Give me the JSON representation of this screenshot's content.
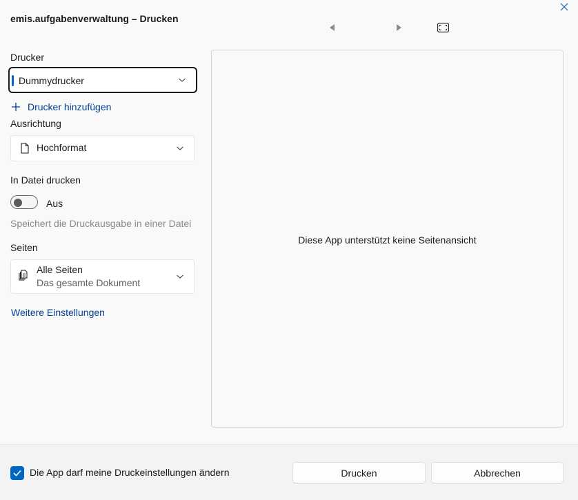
{
  "window": {
    "title": "emis.aufgabenverwaltung – Drucken"
  },
  "printer": {
    "label": "Drucker",
    "selected": "Dummydrucker",
    "add_link": "Drucker hinzufügen"
  },
  "orientation": {
    "label": "Ausrichtung",
    "selected": "Hochformat"
  },
  "print_to_file": {
    "label": "In Datei drucken",
    "state_text": "Aus",
    "description": "Speichert die Druckausgabe in einer Datei"
  },
  "pages": {
    "label": "Seiten",
    "selected": "Alle Seiten",
    "selected_subtitle": "Das gesamte Dokument"
  },
  "more_settings_link": "Weitere Einstellungen",
  "preview": {
    "message": "Diese App unterstützt keine Seitenansicht"
  },
  "footer": {
    "checkbox_label": "Die App darf meine Druckeinstellungen ändern",
    "checkbox_checked": true,
    "print_button": "Drucken",
    "cancel_button": "Abbrechen"
  },
  "colors": {
    "accent": "#0067c0",
    "link": "#003e92"
  },
  "icons": {
    "close": "close-icon",
    "prev_page": "triangle-left-icon",
    "next_page": "triangle-right-icon",
    "fit": "fit-page-icon",
    "orientation": "document-icon",
    "pages": "documents-stack-icon",
    "add": "plus-icon",
    "dropdown": "chevron-down-icon",
    "check": "checkmark-icon"
  }
}
